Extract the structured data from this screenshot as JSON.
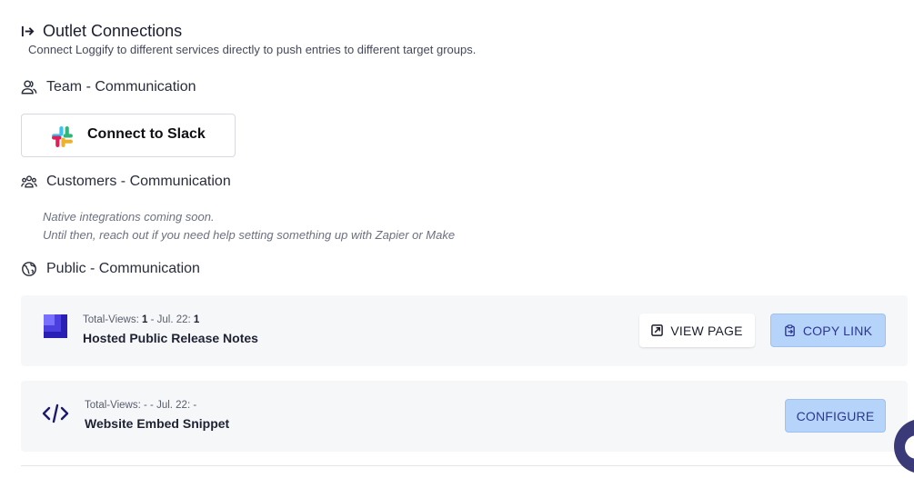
{
  "header": {
    "title": "Outlet Connections",
    "subtitle": "Connect Loggify to different services directly to push entries to different target groups."
  },
  "sections": {
    "team": {
      "label": "Team - Communication"
    },
    "customers": {
      "label": "Customers - Communication"
    },
    "public": {
      "label": "Public - Communication"
    }
  },
  "slack": {
    "button_label": "Connect to Slack"
  },
  "customers_note": {
    "line1": "Native integrations coming soon.",
    "line2": "Until then, reach out if you need help setting something up with Zapier or Make"
  },
  "outlets": {
    "release_notes": {
      "views_label": "Total-Views:",
      "views_total": "1",
      "period_label": "- Jul. 22:",
      "views_period": "1",
      "name": "Hosted Public Release Notes",
      "view_button": "VIEW PAGE",
      "copy_button": "COPY LINK"
    },
    "embed": {
      "views_label": "Total-Views:",
      "views_total": "-",
      "period_label": "- Jul. 22:",
      "views_period": "-",
      "name": "Website Embed Snippet",
      "configure_button": "CONFIGURE"
    }
  },
  "colors": {
    "accent_button_bg": "#b6d3fa",
    "accent_button_text": "#2c3794",
    "card_bg": "#f6f7f9",
    "chat_fab": "#3b3a78"
  },
  "icons": {
    "title": "arrow-right-to-bar-icon",
    "team": "users-icon",
    "customers": "users-group-icon",
    "public": "globe-icon",
    "slack": "slack-logo-icon",
    "release_notes": "release-notes-logo-icon",
    "embed": "code-icon",
    "view_page": "external-link-icon",
    "copy_link": "clipboard-copy-icon",
    "chat": "chat-bubble-icon"
  }
}
